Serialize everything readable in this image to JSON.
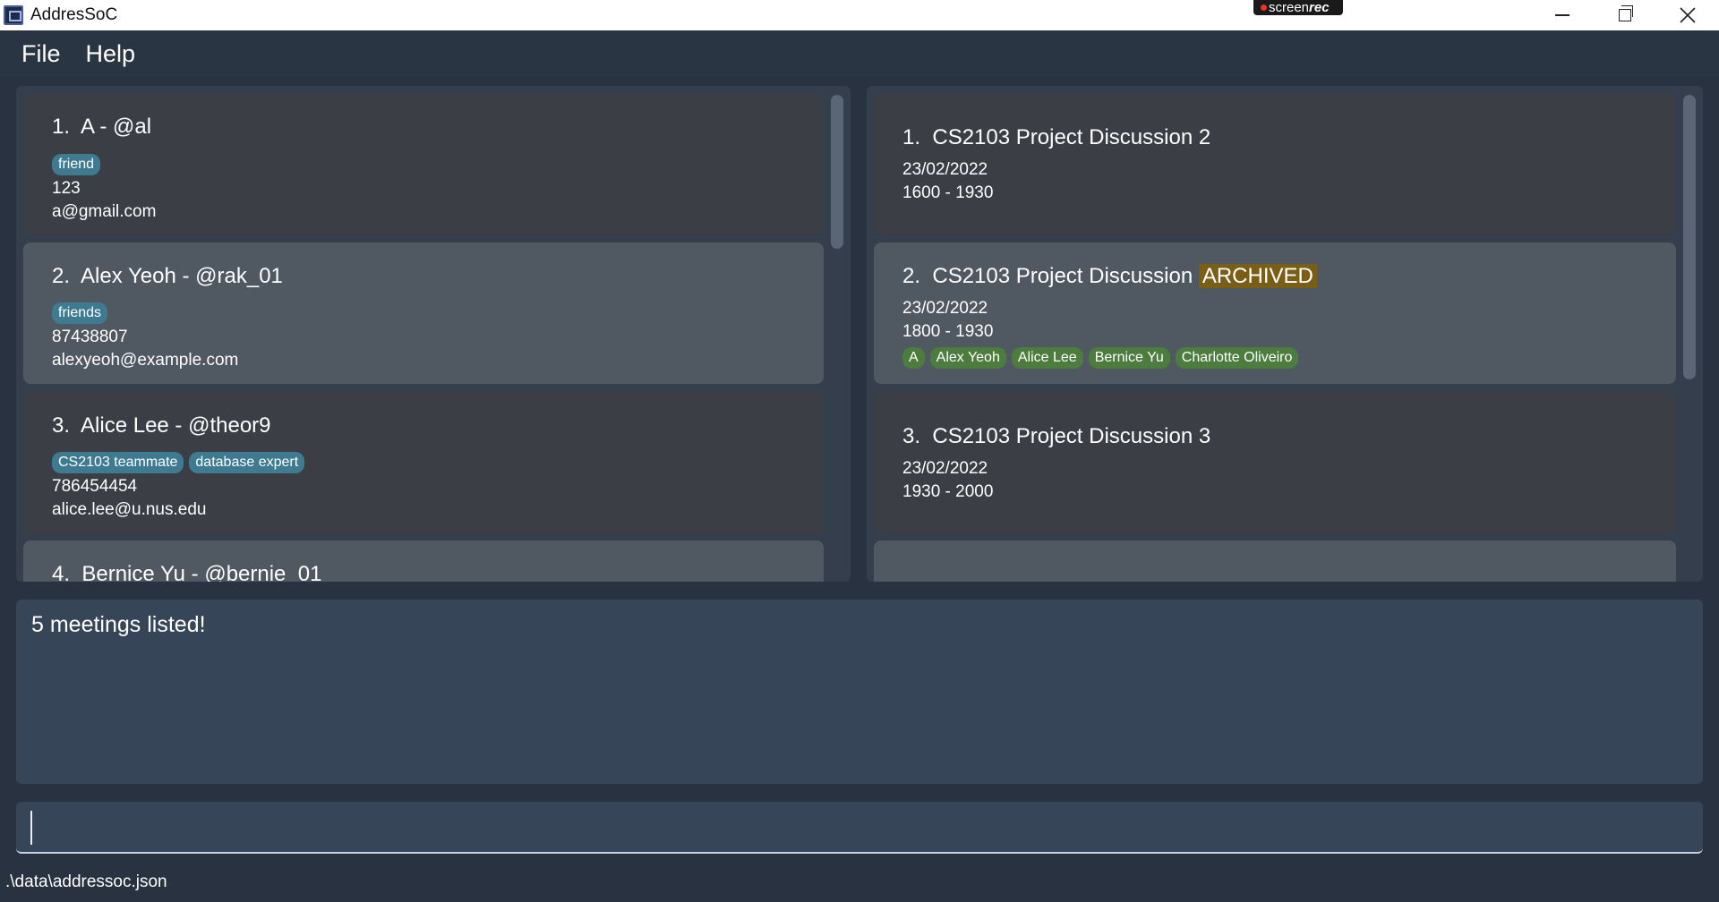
{
  "window": {
    "title": "AddresSoC",
    "recorder_label_left": "screen",
    "recorder_label_right": "rec"
  },
  "menu": [
    "File",
    "Help"
  ],
  "persons": [
    {
      "index": "1.",
      "name": "A",
      "handle": "@al",
      "tags": [
        "friend"
      ],
      "phone": "123",
      "email": "a@gmail.com"
    },
    {
      "index": "2.",
      "name": "Alex Yeoh",
      "handle": "@rak_01",
      "tags": [
        "friends"
      ],
      "phone": "87438807",
      "email": "alexyeoh@example.com"
    },
    {
      "index": "3.",
      "name": "Alice Lee",
      "handle": "@theor9",
      "tags": [
        "CS2103 teammate",
        "database expert"
      ],
      "phone": "786454454",
      "email": "alice.lee@u.nus.edu"
    },
    {
      "index": "4.",
      "name": "Bernice Yu",
      "handle": "@bernie_01"
    }
  ],
  "meetings": [
    {
      "index": "1.",
      "title": "CS2103 Project Discussion 2",
      "date": "23/02/2022",
      "time": "1600 - 1930"
    },
    {
      "index": "2.",
      "title": "CS2103 Project Discussion",
      "badge": "ARCHIVED",
      "date": "23/02/2022",
      "time": "1800 - 1930",
      "participants": [
        "A",
        "Alex Yeoh",
        "Alice Lee",
        "Bernice Yu",
        "Charlotte Oliveiro"
      ]
    },
    {
      "index": "3.",
      "title": "CS2103 Project Discussion 3",
      "date": "23/02/2022",
      "time": "1930 - 2000"
    }
  ],
  "result": {
    "message": "5 meetings listed!"
  },
  "command": {
    "value": ""
  },
  "status": {
    "file_path": ".\\data\\addressoc.json"
  },
  "colors": {
    "tag": "#3e7b91",
    "participant_tag": "#4c7d3e",
    "archived": "#7a5e16",
    "background": "#283240"
  }
}
